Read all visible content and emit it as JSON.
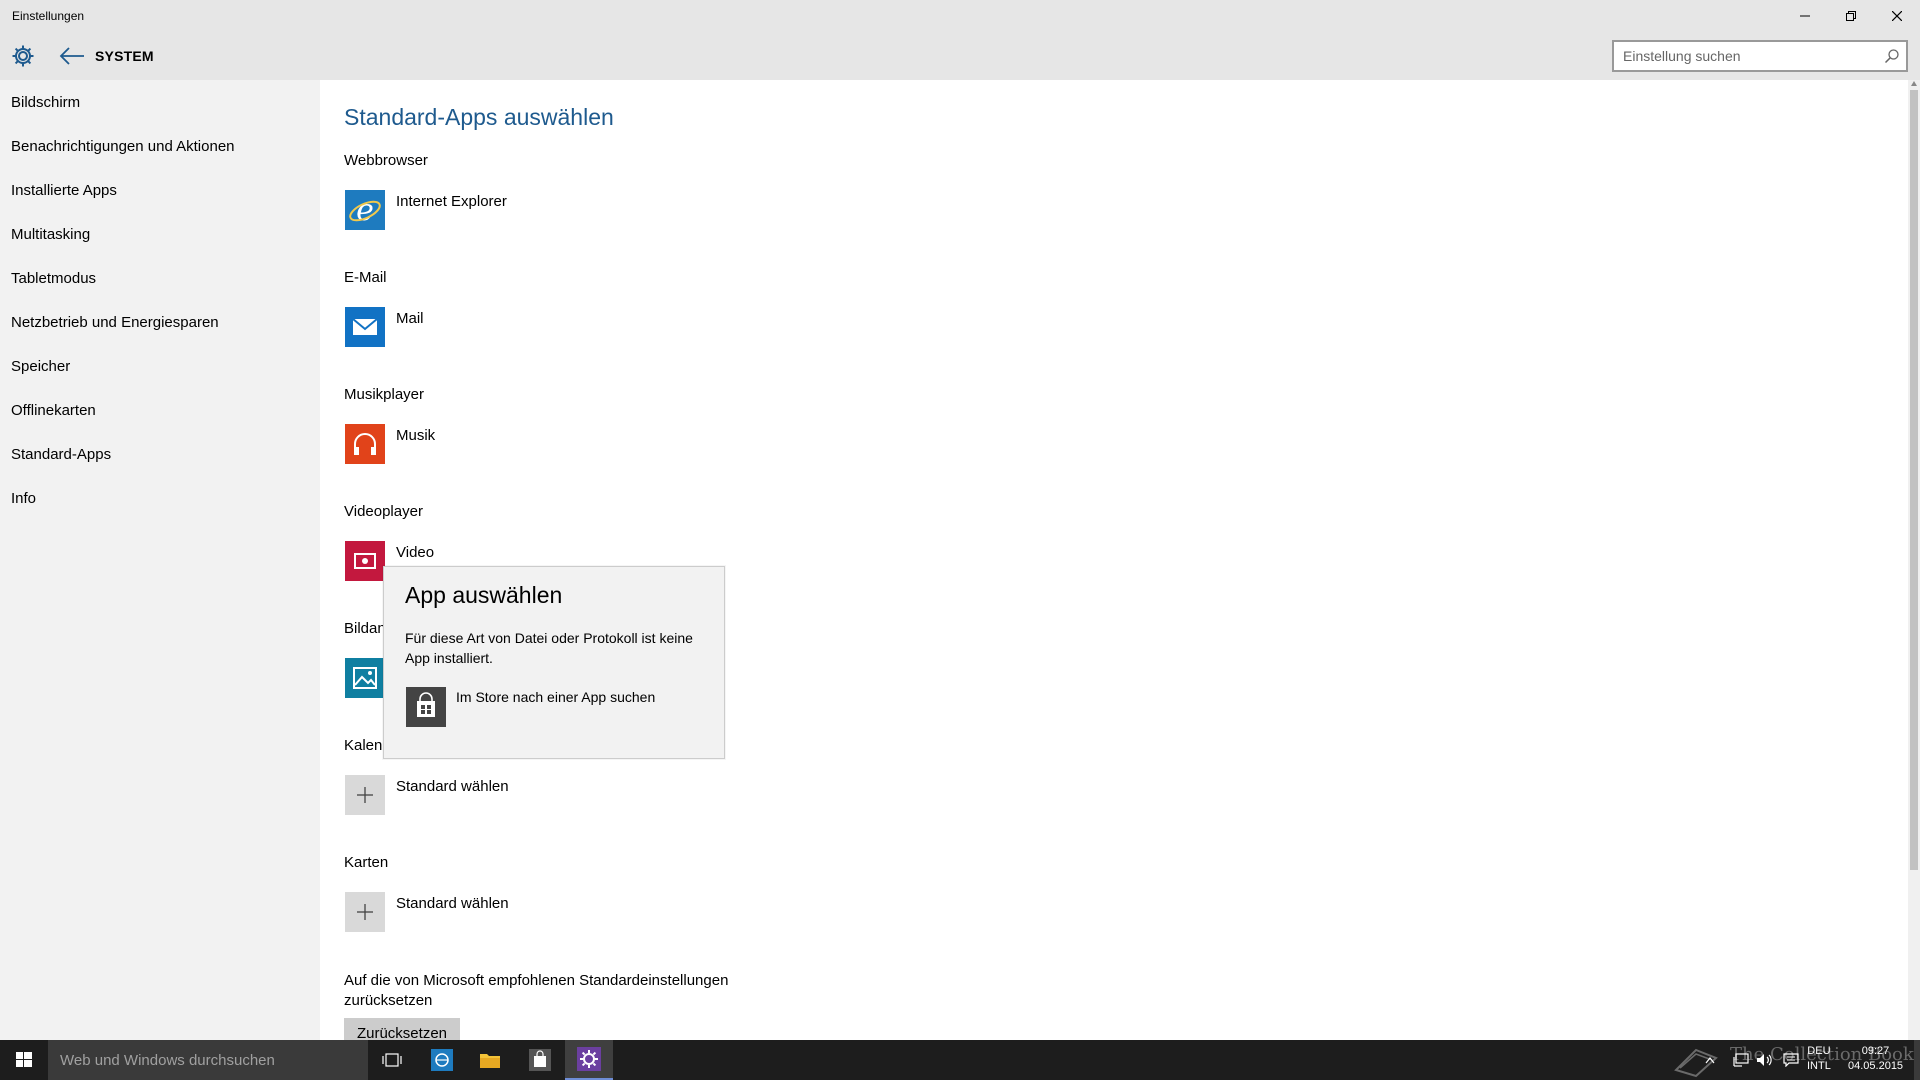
{
  "window": {
    "title": "Einstellungen"
  },
  "header": {
    "section": "SYSTEM",
    "search_placeholder": "Einstellung suchen"
  },
  "sidebar": {
    "items": [
      {
        "label": "Bildschirm"
      },
      {
        "label": "Benachrichtigungen und Aktionen"
      },
      {
        "label": "Installierte Apps"
      },
      {
        "label": "Multitasking"
      },
      {
        "label": "Tabletmodus"
      },
      {
        "label": "Netzbetrieb und Energiesparen"
      },
      {
        "label": "Speicher"
      },
      {
        "label": "Offlinekarten"
      },
      {
        "label": "Standard-Apps"
      },
      {
        "label": "Info"
      }
    ]
  },
  "main": {
    "title": "Standard-Apps auswählen",
    "categories": [
      {
        "label": "Webbrowser",
        "app": "Internet Explorer",
        "icon": "internet-explorer-icon"
      },
      {
        "label": "E-Mail",
        "app": "Mail",
        "icon": "mail-icon"
      },
      {
        "label": "Musikplayer",
        "app": "Musik",
        "icon": "music-headphones-icon"
      },
      {
        "label": "Videoplayer",
        "app": "Video",
        "icon": "video-icon"
      },
      {
        "label": "Bildan",
        "app": "",
        "icon": "photos-icon"
      },
      {
        "label": "Kalend",
        "app": "Standard wählen",
        "icon": "plus-icon"
      },
      {
        "label": "Karten",
        "app": "Standard wählen",
        "icon": "plus-icon"
      }
    ],
    "reset_text": "Auf die von Microsoft empfohlenen Standardeinstellungen zurücksetzen",
    "reset_button": "Zurücksetzen"
  },
  "flyout": {
    "title": "App auswählen",
    "description": "Für diese Art von Datei oder Protokoll ist keine App installiert.",
    "store_link": "Im Store nach einer App suchen"
  },
  "taskbar": {
    "search_placeholder": "Web und Windows durchsuchen",
    "watermark": "The Collection Book",
    "lang_top": "DEU",
    "lang_bottom": "INTL",
    "time": "09:27",
    "date": "04.05.2015"
  },
  "colors": {
    "accent": "#1e5a8e",
    "ie_tile": "#1e7bbf",
    "mail_tile": "#1172c4",
    "music_tile": "#e1431a",
    "video_tile": "#c3183e",
    "photos_tile": "#0f7fa1",
    "taskbar": "#1d1d1d"
  }
}
